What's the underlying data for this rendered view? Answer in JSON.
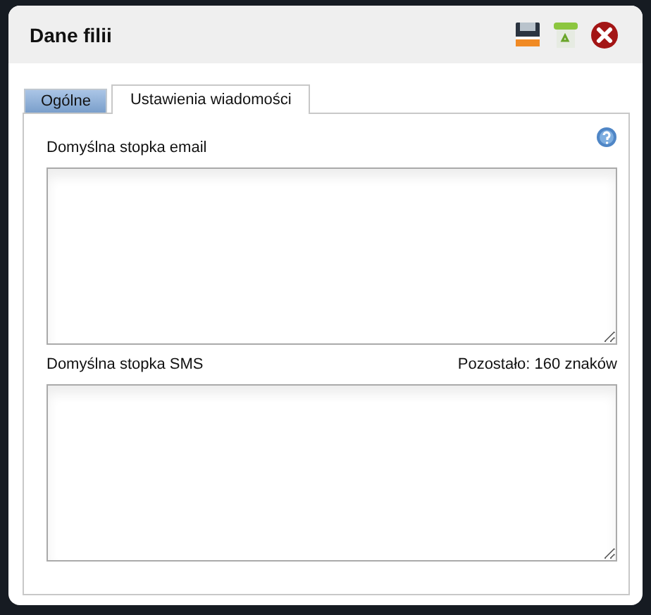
{
  "window": {
    "title": "Dane filii"
  },
  "tabs": [
    {
      "label": "Ogólne",
      "selected": false
    },
    {
      "label": "Ustawienia wiadomości",
      "selected": true
    }
  ],
  "fields": [
    {
      "label": "Domyślna stopka email",
      "help": true
    },
    {
      "label": "Domyślna stopka SMS",
      "counter": "Pozostało: 160 znaków"
    }
  ]
}
